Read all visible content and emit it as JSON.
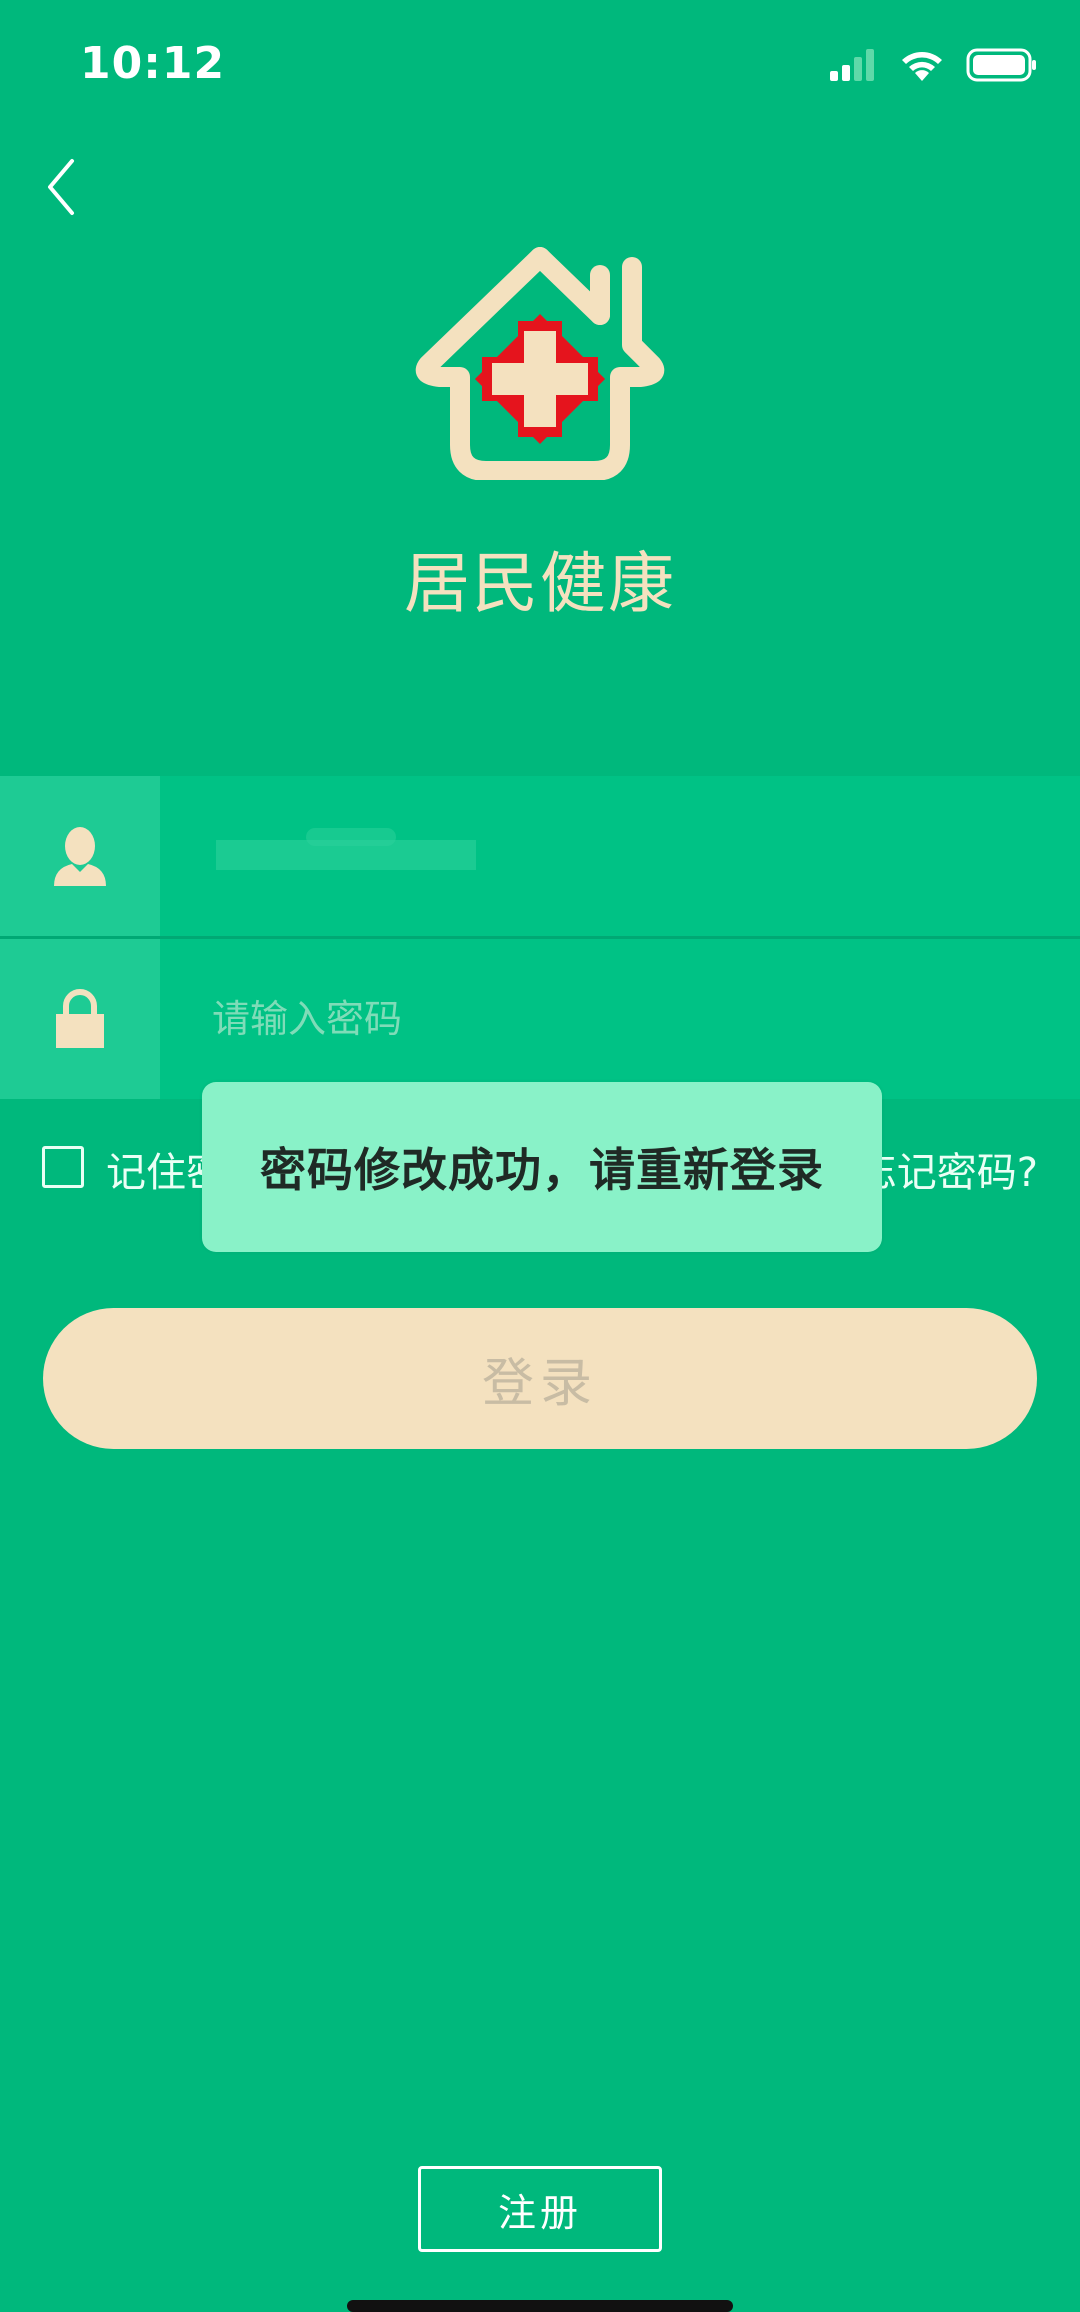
{
  "status_bar": {
    "time": "10:12",
    "signal_icon": "signal-icon",
    "wifi_icon": "wifi-icon",
    "battery_icon": "battery-icon"
  },
  "header": {
    "back_icon": "chevron-left-icon"
  },
  "app": {
    "logo_icon": "house-medical-cross-icon",
    "title": "居民健康"
  },
  "form": {
    "username": {
      "icon": "user-icon",
      "value": ""
    },
    "password": {
      "icon": "lock-icon",
      "placeholder": "请输入密码"
    },
    "remember_label": "记住密码",
    "forgot_label": "忘记密码?"
  },
  "toast": {
    "message": "密码修改成功，请重新登录"
  },
  "buttons": {
    "login_label": "登录",
    "register_label": "注册"
  },
  "colors": {
    "background": "#00b87c",
    "accent": "#f4e1bf",
    "toast": "#89f2c8",
    "cross": "#e5141d"
  }
}
